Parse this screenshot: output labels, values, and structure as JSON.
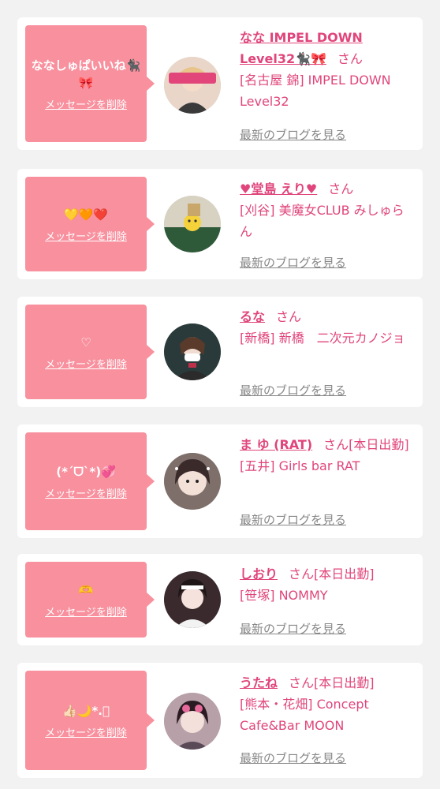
{
  "colors": {
    "accent": "#e0457b",
    "bubble": "#f8909e",
    "link_gray": "#888888"
  },
  "labels": {
    "san": "さん",
    "delete": "メッセージを削除",
    "blog": "最新のブログを見る"
  },
  "cards": [
    {
      "message": "ななしゅぱいいね🐈‍⬛🎀",
      "name": "なな IMPEL DOWN Level32🐈‍⬛🎀",
      "suffix": "",
      "shop": "[名古屋 錦] IMPEL DOWN Level32"
    },
    {
      "message": "💛🧡❤️",
      "name": "♥堂島 えり♥",
      "suffix": "",
      "shop": "[刈谷] 美魔女CLUB みしゅらん"
    },
    {
      "message": "♡",
      "name": "るな",
      "suffix": "",
      "shop": "[新橋] 新橋　二次元カノジョ"
    },
    {
      "message": "(*ˊᗜˋ*)💞",
      "name": "ま ゆ (RAT)",
      "suffix": "[本日出勤]",
      "shop": "[五井] Girls bar RAT"
    },
    {
      "message": "🫶",
      "name": "しおり",
      "suffix": "[本日出勤]",
      "shop": "[笹塚] NOMMY"
    },
    {
      "message": "👍🏻🌙*.ﾟ",
      "name": "うたね",
      "suffix": "[本日出勤]",
      "shop": "[熊本・花畑] Concept Cafe&Bar MOON"
    }
  ]
}
